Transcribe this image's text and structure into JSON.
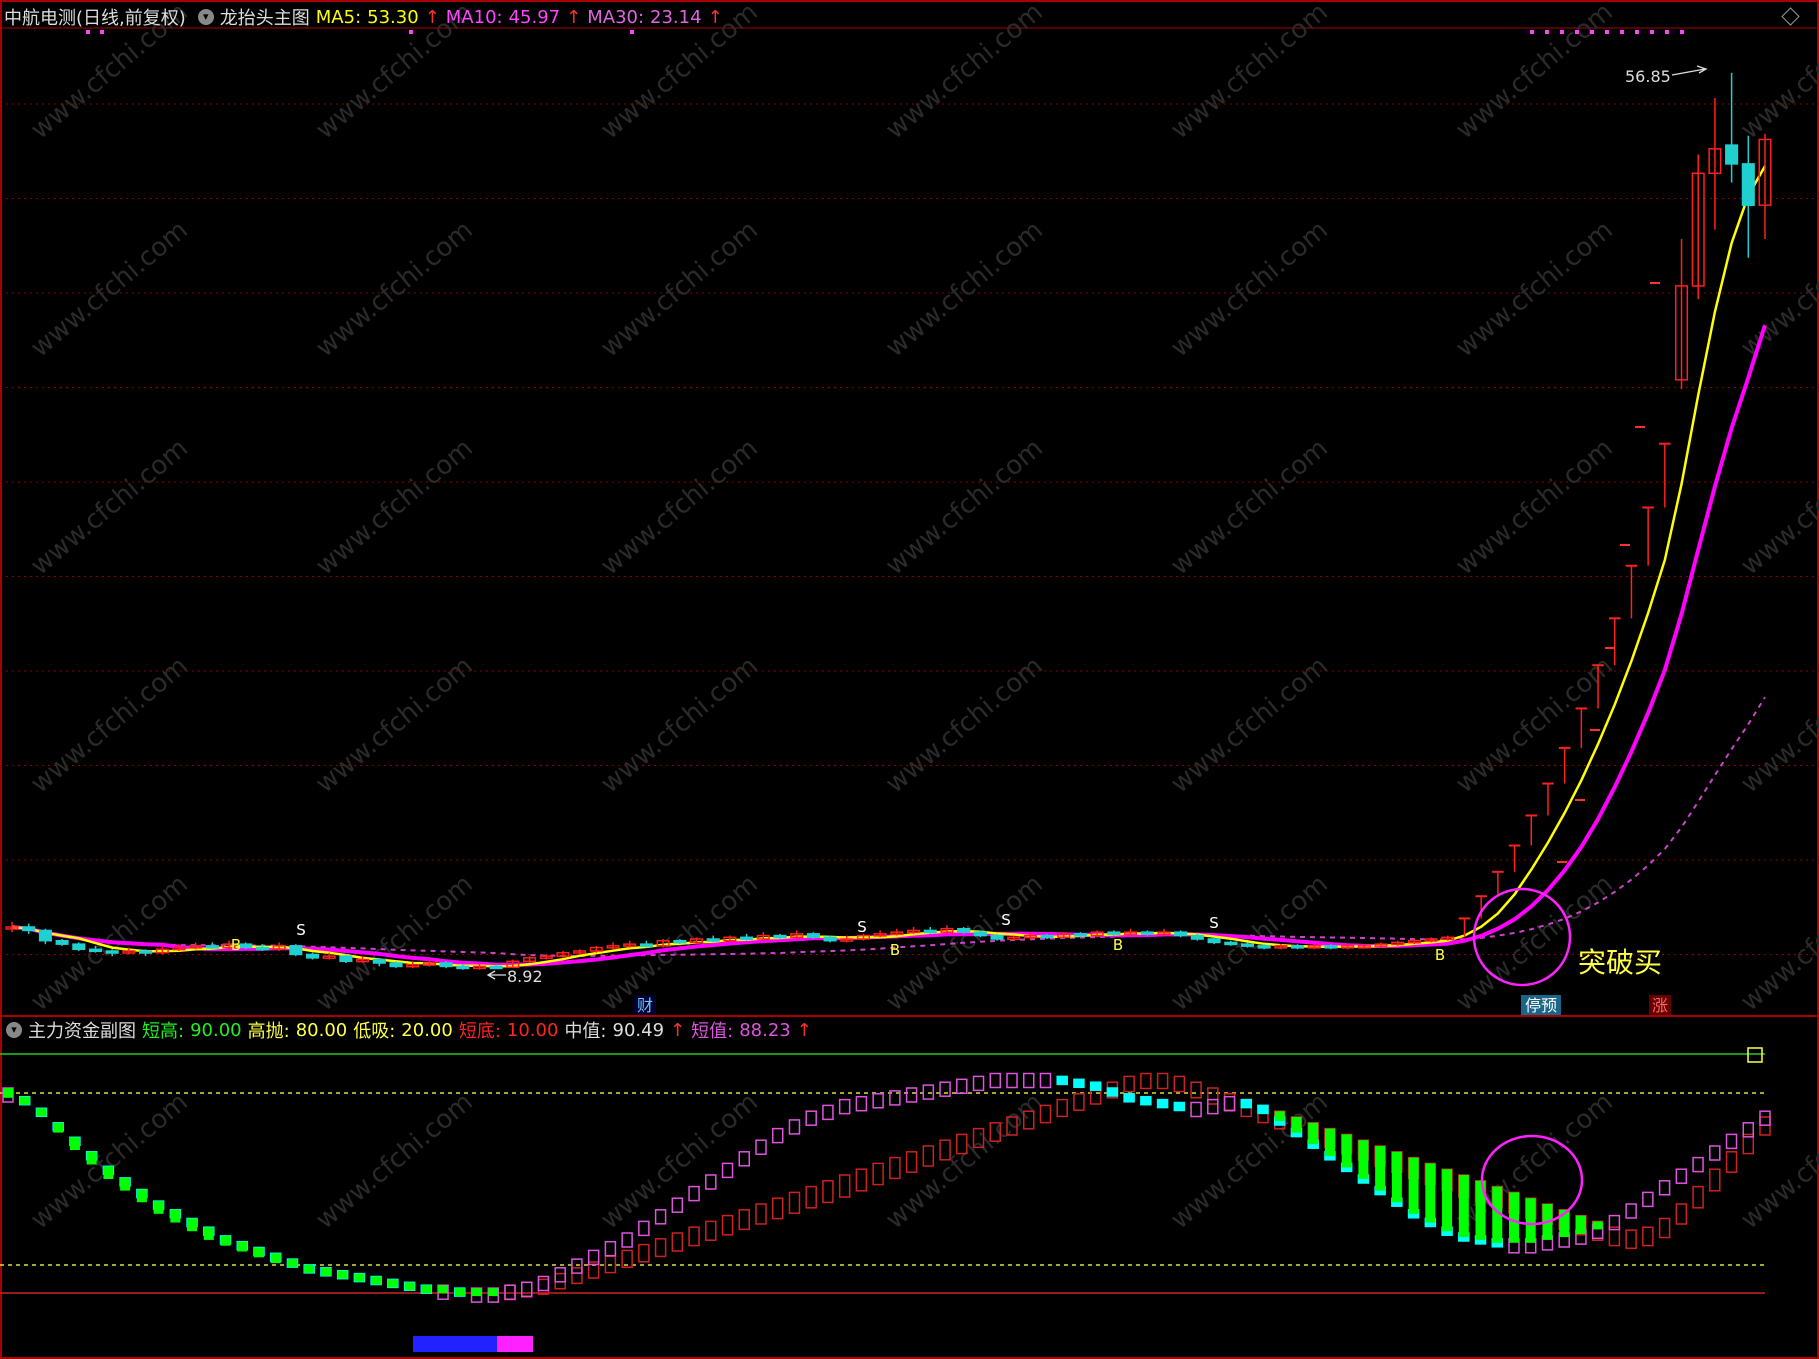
{
  "main_header": {
    "stock_label": "中航电测(日线,前复权)",
    "indicator_name": "龙抬头主图",
    "ma5_label": "MA5:",
    "ma5_value": "53.30",
    "ma10_label": "MA10:",
    "ma10_value": "45.97",
    "ma30_label": "MA30:",
    "ma30_value": "23.14",
    "arrow": "↑"
  },
  "sub_header": {
    "indicator_name": "主力资金副图",
    "short_high_label": "短高:",
    "short_high_value": "90.00",
    "high_sell_label": "高抛:",
    "high_sell_value": "80.00",
    "low_buy_label": "低吸:",
    "low_buy_value": "20.00",
    "short_low_label": "短底:",
    "short_low_value": "10.00",
    "mid_label": "中值:",
    "mid_value": "90.49",
    "short_val_label": "短值:",
    "short_val_value": "88.23",
    "arrow": "↑"
  },
  "annotations": {
    "high_price": "56.85",
    "low_price": "8.92",
    "breakout_text": "突破买",
    "marker_cai": "财",
    "marker_tingyu": "停预",
    "marker_zhang": "涨",
    "watermark": "www.cfchi.com"
  },
  "colors": {
    "ma5": "#ffff00",
    "ma10": "#ff00ff",
    "ma30": "#cc44cc",
    "up": "#ff2020",
    "down": "#20d0d0",
    "grid": "#8b0000",
    "green": "#00ff00",
    "cyan": "#00ffff",
    "magenta": "#dd55dd",
    "red_box": "#cc2222"
  },
  "chart_data": [
    {
      "type": "line",
      "name": "main_price",
      "x_count": 106,
      "ylim": [
        5,
        62
      ],
      "candles": [
        {
          "i": 0,
          "o": 11.2,
          "c": 11.3,
          "h": 11.6,
          "l": 11.0
        },
        {
          "i": 1,
          "o": 11.3,
          "c": 11.1,
          "h": 11.5,
          "l": 10.9
        },
        {
          "i": 2,
          "o": 11.1,
          "c": 10.5,
          "h": 11.2,
          "l": 10.3
        },
        {
          "i": 3,
          "o": 10.5,
          "c": 10.3,
          "h": 10.6,
          "l": 10.2
        },
        {
          "i": 4,
          "o": 10.3,
          "c": 10.0,
          "h": 10.4,
          "l": 9.9
        },
        {
          "i": 5,
          "o": 10.0,
          "c": 9.9,
          "h": 10.2,
          "l": 9.8
        },
        {
          "i": 6,
          "o": 9.9,
          "c": 9.8,
          "h": 10.0,
          "l": 9.6
        },
        {
          "i": 7,
          "o": 9.8,
          "c": 9.9,
          "h": 10.1,
          "l": 9.7
        },
        {
          "i": 8,
          "o": 9.9,
          "c": 9.8,
          "h": 10.0,
          "l": 9.6
        },
        {
          "i": 9,
          "o": 9.8,
          "c": 10.0,
          "h": 10.2,
          "l": 9.7
        },
        {
          "i": 10,
          "o": 10.0,
          "c": 10.1,
          "h": 10.3,
          "l": 9.9
        },
        {
          "i": 11,
          "o": 10.1,
          "c": 10.2,
          "h": 10.4,
          "l": 10.0
        },
        {
          "i": 12,
          "o": 10.2,
          "c": 10.1,
          "h": 10.4,
          "l": 10.0
        },
        {
          "i": 13,
          "o": 10.1,
          "c": 10.3,
          "h": 10.5,
          "l": 10.0
        },
        {
          "i": 14,
          "o": 10.3,
          "c": 10.1,
          "h": 10.4,
          "l": 10.0
        },
        {
          "i": 15,
          "o": 10.1,
          "c": 10.0,
          "h": 10.3,
          "l": 9.9
        },
        {
          "i": 16,
          "o": 10.0,
          "c": 10.2,
          "h": 10.4,
          "l": 9.9
        },
        {
          "i": 17,
          "o": 10.2,
          "c": 9.7,
          "h": 10.3,
          "l": 9.6
        },
        {
          "i": 18,
          "o": 9.7,
          "c": 9.5,
          "h": 9.8,
          "l": 9.4
        },
        {
          "i": 19,
          "o": 9.5,
          "c": 9.6,
          "h": 9.8,
          "l": 9.4
        },
        {
          "i": 20,
          "o": 9.6,
          "c": 9.3,
          "h": 9.7,
          "l": 9.2
        },
        {
          "i": 21,
          "o": 9.3,
          "c": 9.4,
          "h": 9.6,
          "l": 9.2
        },
        {
          "i": 22,
          "o": 9.4,
          "c": 9.2,
          "h": 9.5,
          "l": 9.0
        },
        {
          "i": 23,
          "o": 9.2,
          "c": 9.0,
          "h": 9.3,
          "l": 8.9
        },
        {
          "i": 24,
          "o": 9.0,
          "c": 9.1,
          "h": 9.3,
          "l": 8.9
        },
        {
          "i": 25,
          "o": 9.1,
          "c": 9.2,
          "h": 9.4,
          "l": 9.0
        },
        {
          "i": 26,
          "o": 9.2,
          "c": 9.0,
          "h": 9.3,
          "l": 8.9
        },
        {
          "i": 27,
          "o": 9.0,
          "c": 8.9,
          "h": 9.1,
          "l": 8.8
        },
        {
          "i": 28,
          "o": 8.9,
          "c": 9.0,
          "h": 9.2,
          "l": 8.8
        },
        {
          "i": 29,
          "o": 9.0,
          "c": 8.92,
          "h": 9.1,
          "l": 8.92
        },
        {
          "i": 30,
          "o": 8.95,
          "c": 9.3,
          "h": 9.4,
          "l": 8.9
        },
        {
          "i": 31,
          "o": 9.3,
          "c": 9.5,
          "h": 9.6,
          "l": 9.2
        },
        {
          "i": 32,
          "o": 9.5,
          "c": 9.6,
          "h": 9.7,
          "l": 9.4
        },
        {
          "i": 33,
          "o": 9.6,
          "c": 9.8,
          "h": 9.9,
          "l": 9.5
        },
        {
          "i": 34,
          "o": 9.8,
          "c": 9.9,
          "h": 10.0,
          "l": 9.7
        },
        {
          "i": 35,
          "o": 9.9,
          "c": 10.1,
          "h": 10.2,
          "l": 9.8
        },
        {
          "i": 36,
          "o": 10.1,
          "c": 10.2,
          "h": 10.4,
          "l": 10.0
        },
        {
          "i": 37,
          "o": 10.2,
          "c": 10.3,
          "h": 10.5,
          "l": 10.1
        },
        {
          "i": 38,
          "o": 10.3,
          "c": 10.2,
          "h": 10.5,
          "l": 10.1
        },
        {
          "i": 39,
          "o": 10.2,
          "c": 10.5,
          "h": 10.6,
          "l": 10.1
        },
        {
          "i": 40,
          "o": 10.5,
          "c": 10.4,
          "h": 10.6,
          "l": 10.3
        },
        {
          "i": 41,
          "o": 10.4,
          "c": 10.6,
          "h": 10.7,
          "l": 10.3
        },
        {
          "i": 42,
          "o": 10.6,
          "c": 10.5,
          "h": 10.8,
          "l": 10.4
        },
        {
          "i": 43,
          "o": 10.5,
          "c": 10.7,
          "h": 10.8,
          "l": 10.4
        },
        {
          "i": 44,
          "o": 10.7,
          "c": 10.6,
          "h": 10.9,
          "l": 10.5
        },
        {
          "i": 45,
          "o": 10.6,
          "c": 10.8,
          "h": 11.0,
          "l": 10.5
        },
        {
          "i": 46,
          "o": 10.8,
          "c": 10.7,
          "h": 10.9,
          "l": 10.6
        },
        {
          "i": 47,
          "o": 10.7,
          "c": 10.9,
          "h": 11.1,
          "l": 10.6
        },
        {
          "i": 48,
          "o": 10.9,
          "c": 10.7,
          "h": 11.0,
          "l": 10.6
        },
        {
          "i": 49,
          "o": 10.7,
          "c": 10.5,
          "h": 10.8,
          "l": 10.4
        },
        {
          "i": 50,
          "o": 10.5,
          "c": 10.6,
          "h": 10.8,
          "l": 10.4
        },
        {
          "i": 51,
          "o": 10.6,
          "c": 10.8,
          "h": 10.9,
          "l": 10.5
        },
        {
          "i": 52,
          "o": 10.8,
          "c": 10.9,
          "h": 11.1,
          "l": 10.7
        },
        {
          "i": 53,
          "o": 10.9,
          "c": 11.0,
          "h": 11.2,
          "l": 10.8
        },
        {
          "i": 54,
          "o": 11.0,
          "c": 11.1,
          "h": 11.3,
          "l": 10.9
        },
        {
          "i": 55,
          "o": 11.1,
          "c": 11.0,
          "h": 11.3,
          "l": 10.9
        },
        {
          "i": 56,
          "o": 11.0,
          "c": 11.2,
          "h": 11.4,
          "l": 10.9
        },
        {
          "i": 57,
          "o": 11.2,
          "c": 11.0,
          "h": 11.3,
          "l": 10.9
        },
        {
          "i": 58,
          "o": 11.0,
          "c": 10.8,
          "h": 11.1,
          "l": 10.7
        },
        {
          "i": 59,
          "o": 10.8,
          "c": 10.6,
          "h": 10.9,
          "l": 10.5
        },
        {
          "i": 60,
          "o": 10.6,
          "c": 10.7,
          "h": 10.8,
          "l": 10.5
        },
        {
          "i": 61,
          "o": 10.7,
          "c": 10.8,
          "h": 11.0,
          "l": 10.6
        },
        {
          "i": 62,
          "o": 10.8,
          "c": 10.7,
          "h": 10.9,
          "l": 10.6
        },
        {
          "i": 63,
          "o": 10.7,
          "c": 10.9,
          "h": 11.0,
          "l": 10.6
        },
        {
          "i": 64,
          "o": 10.9,
          "c": 10.8,
          "h": 11.0,
          "l": 10.7
        },
        {
          "i": 65,
          "o": 10.8,
          "c": 11.0,
          "h": 11.1,
          "l": 10.7
        },
        {
          "i": 66,
          "o": 11.0,
          "c": 10.9,
          "h": 11.1,
          "l": 10.8
        },
        {
          "i": 67,
          "o": 10.9,
          "c": 11.0,
          "h": 11.2,
          "l": 10.8
        },
        {
          "i": 68,
          "o": 11.0,
          "c": 10.9,
          "h": 11.1,
          "l": 10.8
        },
        {
          "i": 69,
          "o": 10.9,
          "c": 11.0,
          "h": 11.2,
          "l": 10.8
        },
        {
          "i": 70,
          "o": 11.0,
          "c": 10.8,
          "h": 11.1,
          "l": 10.7
        },
        {
          "i": 71,
          "o": 10.8,
          "c": 10.6,
          "h": 10.9,
          "l": 10.5
        },
        {
          "i": 72,
          "o": 10.6,
          "c": 10.4,
          "h": 10.7,
          "l": 10.3
        },
        {
          "i": 73,
          "o": 10.4,
          "c": 10.3,
          "h": 10.5,
          "l": 10.2
        },
        {
          "i": 74,
          "o": 10.3,
          "c": 10.2,
          "h": 10.4,
          "l": 10.1
        },
        {
          "i": 75,
          "o": 10.2,
          "c": 10.1,
          "h": 10.3,
          "l": 10.0
        },
        {
          "i": 76,
          "o": 10.1,
          "c": 10.2,
          "h": 10.3,
          "l": 10.0
        },
        {
          "i": 77,
          "o": 10.2,
          "c": 10.1,
          "h": 10.3,
          "l": 10.0
        },
        {
          "i": 78,
          "o": 10.1,
          "c": 10.2,
          "h": 10.3,
          "l": 10.0
        },
        {
          "i": 79,
          "o": 10.2,
          "c": 10.1,
          "h": 10.3,
          "l": 10.0
        },
        {
          "i": 80,
          "o": 10.1,
          "c": 10.2,
          "h": 10.3,
          "l": 10.0
        },
        {
          "i": 81,
          "o": 10.2,
          "c": 10.2,
          "h": 10.3,
          "l": 10.1
        },
        {
          "i": 82,
          "o": 10.2,
          "c": 10.3,
          "h": 10.4,
          "l": 10.1
        },
        {
          "i": 83,
          "o": 10.3,
          "c": 10.4,
          "h": 10.5,
          "l": 10.2
        },
        {
          "i": 84,
          "o": 10.4,
          "c": 10.5,
          "h": 10.6,
          "l": 10.3
        },
        {
          "i": 85,
          "o": 10.5,
          "c": 10.6,
          "h": 10.7,
          "l": 10.4
        },
        {
          "i": 86,
          "o": 10.6,
          "c": 10.7,
          "h": 10.8,
          "l": 10.5
        },
        {
          "i": 87,
          "o": 10.7,
          "c": 11.8,
          "h": 11.8,
          "l": 10.7
        },
        {
          "i": 88,
          "o": 11.8,
          "c": 13.0,
          "h": 13.0,
          "l": 11.8
        },
        {
          "i": 89,
          "o": 13.0,
          "c": 14.3,
          "h": 14.3,
          "l": 13.0
        },
        {
          "i": 90,
          "o": 14.3,
          "c": 15.7,
          "h": 15.7,
          "l": 14.3
        },
        {
          "i": 91,
          "o": 15.7,
          "c": 17.3,
          "h": 17.3,
          "l": 15.7
        },
        {
          "i": 92,
          "o": 17.3,
          "c": 19.0,
          "h": 19.0,
          "l": 17.3
        },
        {
          "i": 93,
          "o": 19.0,
          "c": 20.9,
          "h": 20.9,
          "l": 19.0
        },
        {
          "i": 94,
          "o": 20.9,
          "c": 23.0,
          "h": 23.0,
          "l": 20.9
        },
        {
          "i": 95,
          "o": 23.0,
          "c": 25.3,
          "h": 25.3,
          "l": 23.0
        },
        {
          "i": 96,
          "o": 25.3,
          "c": 27.8,
          "h": 27.8,
          "l": 25.3
        },
        {
          "i": 97,
          "o": 27.8,
          "c": 30.6,
          "h": 30.6,
          "l": 27.8
        },
        {
          "i": 98,
          "o": 30.6,
          "c": 33.7,
          "h": 33.7,
          "l": 30.6
        },
        {
          "i": 99,
          "o": 33.7,
          "c": 37.1,
          "h": 37.1,
          "l": 33.7
        },
        {
          "i": 100,
          "o": 40.5,
          "c": 45.5,
          "h": 48.0,
          "l": 40.0
        },
        {
          "i": 101,
          "o": 45.5,
          "c": 51.5,
          "h": 52.5,
          "l": 44.8
        },
        {
          "i": 102,
          "o": 51.5,
          "c": 52.8,
          "h": 55.5,
          "l": 48.5
        },
        {
          "i": 103,
          "o": 53.0,
          "c": 52.0,
          "h": 56.85,
          "l": 51.0
        },
        {
          "i": 104,
          "o": 52.0,
          "c": 49.8,
          "h": 53.5,
          "l": 47.0
        },
        {
          "i": 105,
          "o": 49.8,
          "c": 53.3,
          "h": 53.6,
          "l": 48.0
        }
      ]
    },
    {
      "type": "bar",
      "name": "sub_capital_flow",
      "ylim": [
        0,
        100
      ],
      "levels": [
        90,
        80,
        20,
        10
      ],
      "short_line": [
        80,
        77,
        73,
        68,
        63,
        58,
        53,
        49,
        45,
        41,
        38,
        35,
        32,
        29,
        27,
        25,
        23,
        21,
        19,
        18,
        17,
        16,
        15,
        14,
        13,
        12,
        12,
        11,
        11,
        11,
        12,
        13,
        15,
        18,
        21,
        24,
        27,
        30,
        34,
        38,
        42,
        46,
        50,
        54,
        58,
        62,
        66,
        69,
        72,
        74,
        76,
        77,
        78,
        79,
        80,
        81,
        82,
        83,
        84,
        85,
        85,
        85,
        85,
        84,
        83,
        82,
        80,
        78,
        77,
        76,
        75,
        75,
        76,
        77,
        76,
        74,
        70,
        66,
        62,
        58,
        54,
        50,
        46,
        42,
        38,
        35,
        32,
        30,
        29,
        28,
        28,
        28,
        29,
        30,
        31,
        33,
        36,
        40,
        44,
        48,
        52,
        56,
        60,
        64,
        68,
        72
      ],
      "mid_line": [
        78,
        76,
        72,
        66,
        60,
        55,
        50,
        46,
        42,
        38,
        35,
        32,
        29,
        27,
        25,
        23,
        21,
        20,
        18,
        17,
        16,
        15,
        14,
        13,
        12,
        12,
        11,
        11,
        11,
        11,
        12,
        13,
        14,
        16,
        18,
        20,
        22,
        24,
        26,
        28,
        30,
        32,
        34,
        36,
        38,
        40,
        42,
        44,
        46,
        48,
        50,
        52,
        54,
        56,
        58,
        60,
        62,
        64,
        66,
        68,
        70,
        72,
        74,
        76,
        78,
        80,
        82,
        84,
        85,
        85,
        84,
        82,
        80,
        78,
        76,
        74,
        72,
        70,
        68,
        66,
        64,
        62,
        60,
        58,
        56,
        54,
        52,
        50,
        48,
        46,
        44,
        42,
        40,
        38,
        36,
        34,
        32,
        31,
        32,
        35,
        40,
        46,
        52,
        58,
        64,
        70
      ],
      "bottom_bar_colors": [
        "#2222ff",
        "#ff22ff"
      ]
    }
  ]
}
